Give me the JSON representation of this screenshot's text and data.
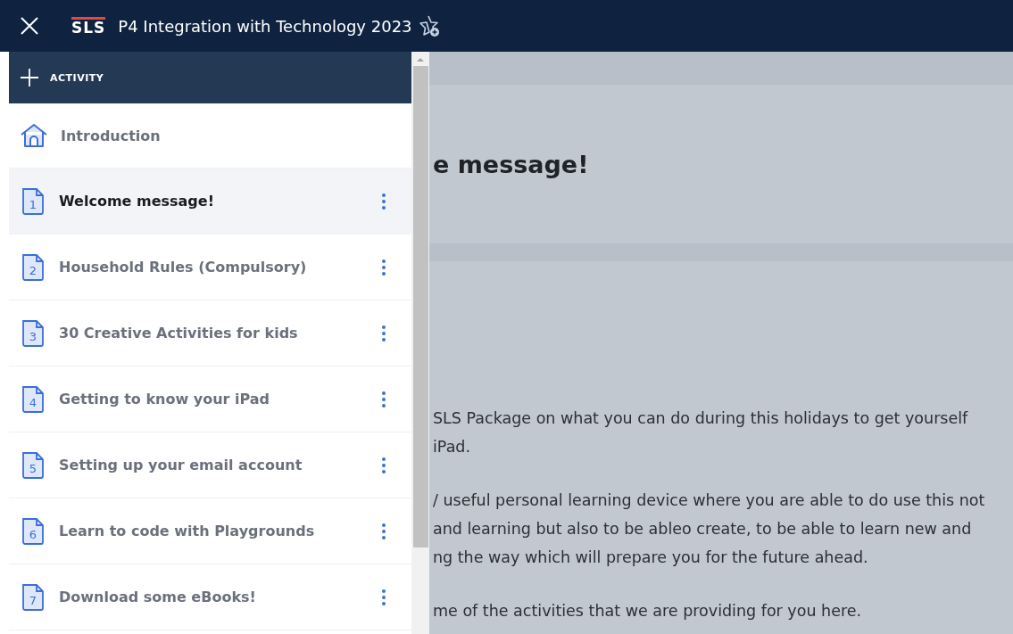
{
  "header": {
    "logo": "SLS",
    "title": "P4 Integration with Technology 2023"
  },
  "sidebar": {
    "add_button": "ACTIVITY",
    "items": [
      {
        "kind": "home",
        "label": "Introduction",
        "selected": false
      },
      {
        "kind": "activity",
        "number": "1",
        "label": "Welcome message!",
        "selected": true
      },
      {
        "kind": "activity",
        "number": "2",
        "label": "Household Rules (Compulsory)",
        "selected": false
      },
      {
        "kind": "activity",
        "number": "3",
        "label": "30 Creative Activities for kids",
        "selected": false
      },
      {
        "kind": "activity",
        "number": "4",
        "label": "Getting to know your iPad",
        "selected": false
      },
      {
        "kind": "activity",
        "number": "5",
        "label": "Setting up your email account",
        "selected": false
      },
      {
        "kind": "activity",
        "number": "6",
        "label": "Learn to code with Playgrounds",
        "selected": false
      },
      {
        "kind": "activity",
        "number": "7",
        "label": "Download some eBooks!",
        "selected": false
      }
    ]
  },
  "content": {
    "title": "e message!",
    "paragraphs": [
      [
        "SLS Package on what you can do during this holidays to get yourself",
        "iPad."
      ],
      [
        "/ useful personal learning device where you are able to do use this not",
        "and learning but also to be ableo create, to be able to learn new and",
        "ng the way which will prepare you for the future ahead."
      ],
      [
        "me of the activities that we are providing for you here."
      ]
    ]
  }
}
